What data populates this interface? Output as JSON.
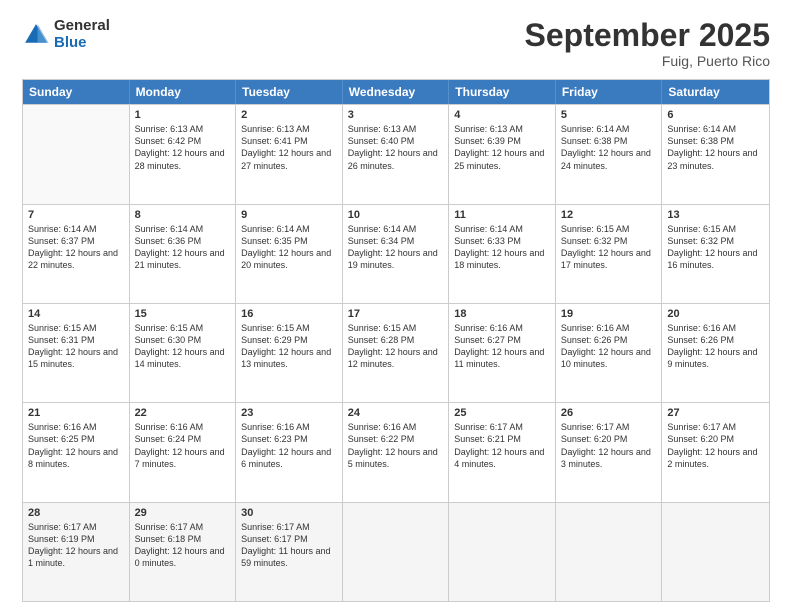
{
  "header": {
    "logo": {
      "line1": "General",
      "line2": "Blue"
    },
    "month_year": "September 2025",
    "location": "Fuig, Puerto Rico"
  },
  "weekdays": [
    "Sunday",
    "Monday",
    "Tuesday",
    "Wednesday",
    "Thursday",
    "Friday",
    "Saturday"
  ],
  "rows": [
    [
      {
        "day": "",
        "sunrise": "",
        "sunset": "",
        "daylight": ""
      },
      {
        "day": "1",
        "sunrise": "Sunrise: 6:13 AM",
        "sunset": "Sunset: 6:42 PM",
        "daylight": "Daylight: 12 hours and 28 minutes."
      },
      {
        "day": "2",
        "sunrise": "Sunrise: 6:13 AM",
        "sunset": "Sunset: 6:41 PM",
        "daylight": "Daylight: 12 hours and 27 minutes."
      },
      {
        "day": "3",
        "sunrise": "Sunrise: 6:13 AM",
        "sunset": "Sunset: 6:40 PM",
        "daylight": "Daylight: 12 hours and 26 minutes."
      },
      {
        "day": "4",
        "sunrise": "Sunrise: 6:13 AM",
        "sunset": "Sunset: 6:39 PM",
        "daylight": "Daylight: 12 hours and 25 minutes."
      },
      {
        "day": "5",
        "sunrise": "Sunrise: 6:14 AM",
        "sunset": "Sunset: 6:38 PM",
        "daylight": "Daylight: 12 hours and 24 minutes."
      },
      {
        "day": "6",
        "sunrise": "Sunrise: 6:14 AM",
        "sunset": "Sunset: 6:38 PM",
        "daylight": "Daylight: 12 hours and 23 minutes."
      }
    ],
    [
      {
        "day": "7",
        "sunrise": "Sunrise: 6:14 AM",
        "sunset": "Sunset: 6:37 PM",
        "daylight": "Daylight: 12 hours and 22 minutes."
      },
      {
        "day": "8",
        "sunrise": "Sunrise: 6:14 AM",
        "sunset": "Sunset: 6:36 PM",
        "daylight": "Daylight: 12 hours and 21 minutes."
      },
      {
        "day": "9",
        "sunrise": "Sunrise: 6:14 AM",
        "sunset": "Sunset: 6:35 PM",
        "daylight": "Daylight: 12 hours and 20 minutes."
      },
      {
        "day": "10",
        "sunrise": "Sunrise: 6:14 AM",
        "sunset": "Sunset: 6:34 PM",
        "daylight": "Daylight: 12 hours and 19 minutes."
      },
      {
        "day": "11",
        "sunrise": "Sunrise: 6:14 AM",
        "sunset": "Sunset: 6:33 PM",
        "daylight": "Daylight: 12 hours and 18 minutes."
      },
      {
        "day": "12",
        "sunrise": "Sunrise: 6:15 AM",
        "sunset": "Sunset: 6:32 PM",
        "daylight": "Daylight: 12 hours and 17 minutes."
      },
      {
        "day": "13",
        "sunrise": "Sunrise: 6:15 AM",
        "sunset": "Sunset: 6:32 PM",
        "daylight": "Daylight: 12 hours and 16 minutes."
      }
    ],
    [
      {
        "day": "14",
        "sunrise": "Sunrise: 6:15 AM",
        "sunset": "Sunset: 6:31 PM",
        "daylight": "Daylight: 12 hours and 15 minutes."
      },
      {
        "day": "15",
        "sunrise": "Sunrise: 6:15 AM",
        "sunset": "Sunset: 6:30 PM",
        "daylight": "Daylight: 12 hours and 14 minutes."
      },
      {
        "day": "16",
        "sunrise": "Sunrise: 6:15 AM",
        "sunset": "Sunset: 6:29 PM",
        "daylight": "Daylight: 12 hours and 13 minutes."
      },
      {
        "day": "17",
        "sunrise": "Sunrise: 6:15 AM",
        "sunset": "Sunset: 6:28 PM",
        "daylight": "Daylight: 12 hours and 12 minutes."
      },
      {
        "day": "18",
        "sunrise": "Sunrise: 6:16 AM",
        "sunset": "Sunset: 6:27 PM",
        "daylight": "Daylight: 12 hours and 11 minutes."
      },
      {
        "day": "19",
        "sunrise": "Sunrise: 6:16 AM",
        "sunset": "Sunset: 6:26 PM",
        "daylight": "Daylight: 12 hours and 10 minutes."
      },
      {
        "day": "20",
        "sunrise": "Sunrise: 6:16 AM",
        "sunset": "Sunset: 6:26 PM",
        "daylight": "Daylight: 12 hours and 9 minutes."
      }
    ],
    [
      {
        "day": "21",
        "sunrise": "Sunrise: 6:16 AM",
        "sunset": "Sunset: 6:25 PM",
        "daylight": "Daylight: 12 hours and 8 minutes."
      },
      {
        "day": "22",
        "sunrise": "Sunrise: 6:16 AM",
        "sunset": "Sunset: 6:24 PM",
        "daylight": "Daylight: 12 hours and 7 minutes."
      },
      {
        "day": "23",
        "sunrise": "Sunrise: 6:16 AM",
        "sunset": "Sunset: 6:23 PM",
        "daylight": "Daylight: 12 hours and 6 minutes."
      },
      {
        "day": "24",
        "sunrise": "Sunrise: 6:16 AM",
        "sunset": "Sunset: 6:22 PM",
        "daylight": "Daylight: 12 hours and 5 minutes."
      },
      {
        "day": "25",
        "sunrise": "Sunrise: 6:17 AM",
        "sunset": "Sunset: 6:21 PM",
        "daylight": "Daylight: 12 hours and 4 minutes."
      },
      {
        "day": "26",
        "sunrise": "Sunrise: 6:17 AM",
        "sunset": "Sunset: 6:20 PM",
        "daylight": "Daylight: 12 hours and 3 minutes."
      },
      {
        "day": "27",
        "sunrise": "Sunrise: 6:17 AM",
        "sunset": "Sunset: 6:20 PM",
        "daylight": "Daylight: 12 hours and 2 minutes."
      }
    ],
    [
      {
        "day": "28",
        "sunrise": "Sunrise: 6:17 AM",
        "sunset": "Sunset: 6:19 PM",
        "daylight": "Daylight: 12 hours and 1 minute."
      },
      {
        "day": "29",
        "sunrise": "Sunrise: 6:17 AM",
        "sunset": "Sunset: 6:18 PM",
        "daylight": "Daylight: 12 hours and 0 minutes."
      },
      {
        "day": "30",
        "sunrise": "Sunrise: 6:17 AM",
        "sunset": "Sunset: 6:17 PM",
        "daylight": "Daylight: 11 hours and 59 minutes."
      },
      {
        "day": "",
        "sunrise": "",
        "sunset": "",
        "daylight": ""
      },
      {
        "day": "",
        "sunrise": "",
        "sunset": "",
        "daylight": ""
      },
      {
        "day": "",
        "sunrise": "",
        "sunset": "",
        "daylight": ""
      },
      {
        "day": "",
        "sunrise": "",
        "sunset": "",
        "daylight": ""
      }
    ]
  ]
}
